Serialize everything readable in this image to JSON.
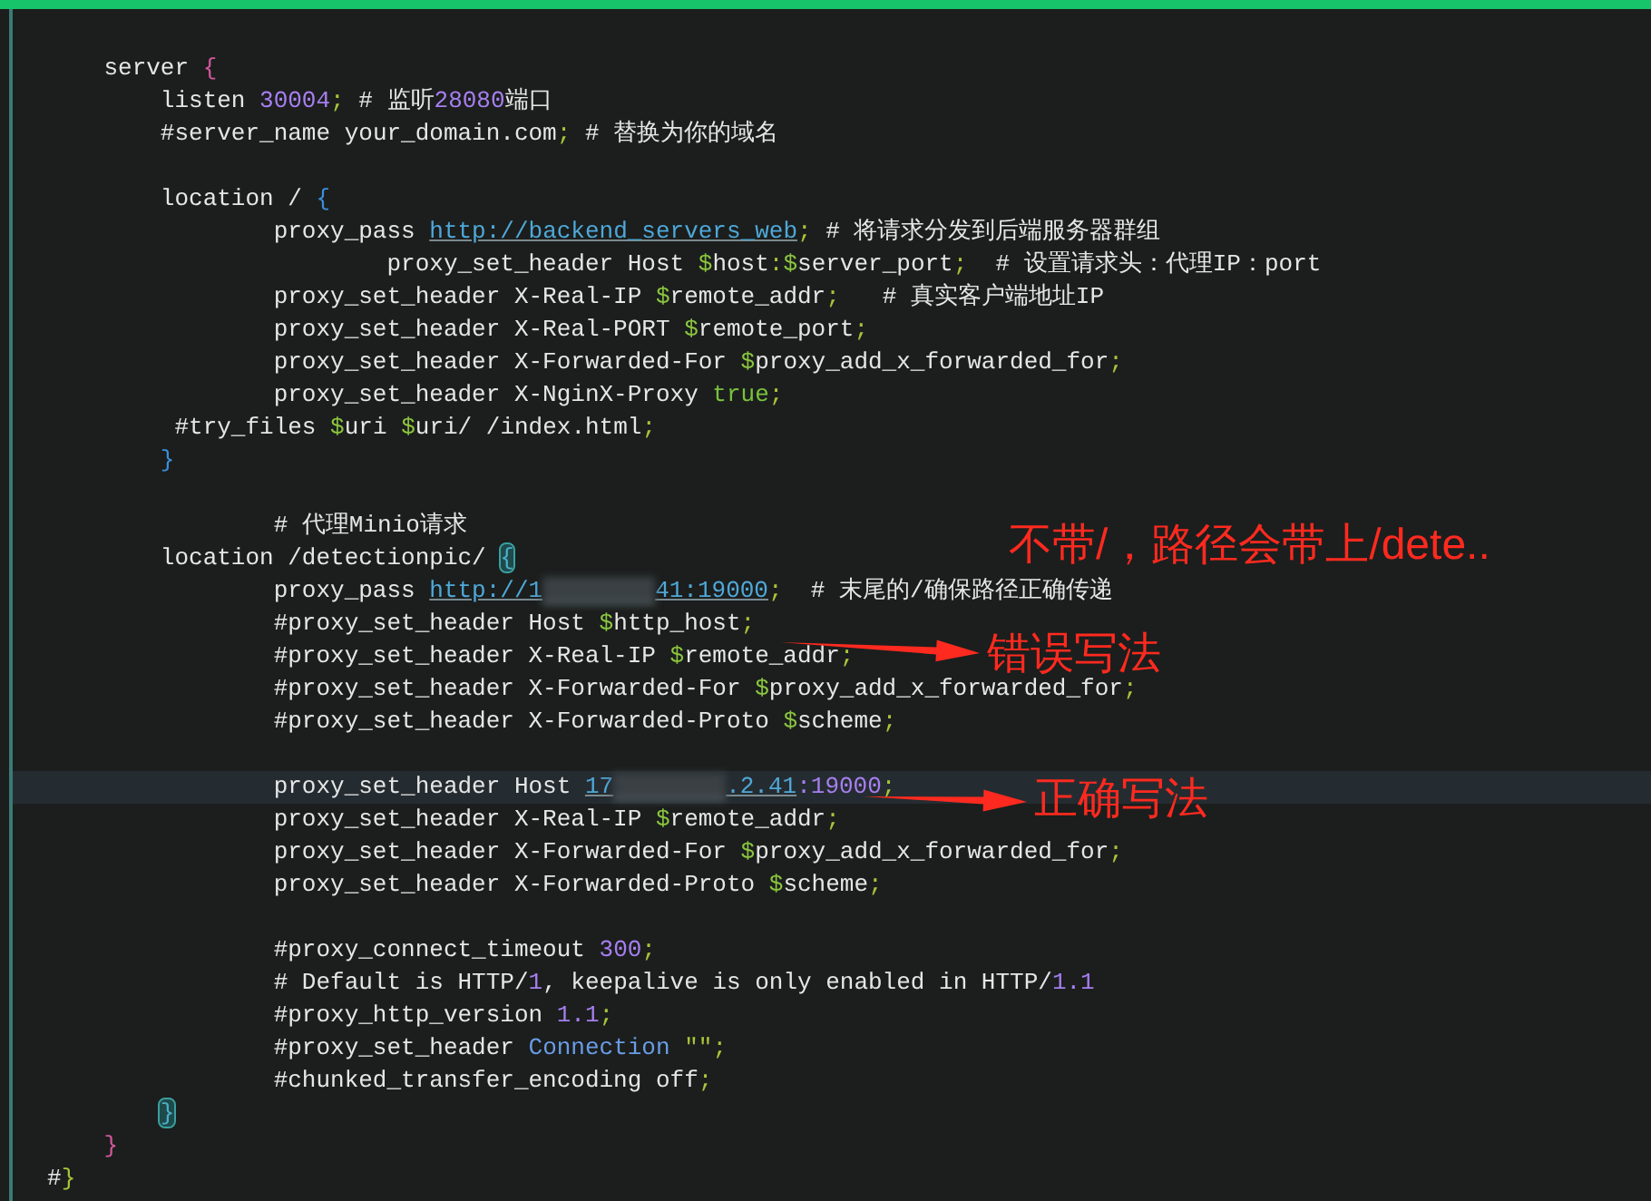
{
  "editor": {
    "lines": [
      {
        "current": false,
        "tokens": [
          {
            "kind": "text",
            "text": "    server "
          },
          {
            "kind": "brace",
            "text": "{"
          }
        ]
      },
      {
        "current": false,
        "tokens": [
          {
            "kind": "text",
            "text": "        listen "
          },
          {
            "kind": "number",
            "text": "30004"
          },
          {
            "kind": "punct",
            "text": ";"
          },
          {
            "kind": "text",
            "text": " # 监听"
          },
          {
            "kind": "number",
            "text": "28080"
          },
          {
            "kind": "text",
            "text": "端口"
          }
        ]
      },
      {
        "current": false,
        "tokens": [
          {
            "kind": "text",
            "text": "        #server_name your_domain.com"
          },
          {
            "kind": "punct",
            "text": ";"
          },
          {
            "kind": "text",
            "text": " # 替换为你的域名"
          }
        ]
      },
      {
        "current": false
      },
      {
        "current": false,
        "tokens": [
          {
            "kind": "text",
            "text": "        location / "
          },
          {
            "kind": "block",
            "text": "{"
          }
        ]
      },
      {
        "current": false,
        "tokens": [
          {
            "kind": "text",
            "text": "                proxy_pass "
          },
          {
            "kind": "url",
            "text": "http://backend_servers_web"
          },
          {
            "kind": "punct",
            "text": ";"
          },
          {
            "kind": "text",
            "text": " # 将请求分发到后端服务器群组"
          }
        ]
      },
      {
        "current": false,
        "tokens": [
          {
            "kind": "text",
            "text": "                        proxy_set_header Host "
          },
          {
            "kind": "variable",
            "text": "$"
          },
          {
            "kind": "text",
            "text": "host"
          },
          {
            "kind": "punct",
            "text": ":"
          },
          {
            "kind": "variable",
            "text": "$"
          },
          {
            "kind": "text",
            "text": "server_port"
          },
          {
            "kind": "punct",
            "text": ";"
          },
          {
            "kind": "text",
            "text": "  # 设置请求头：代理IP：port"
          }
        ]
      },
      {
        "current": false,
        "tokens": [
          {
            "kind": "text",
            "text": "                proxy_set_header X-Real-IP "
          },
          {
            "kind": "variable",
            "text": "$"
          },
          {
            "kind": "text",
            "text": "remote_addr"
          },
          {
            "kind": "punct",
            "text": ";"
          },
          {
            "kind": "text",
            "text": "   # 真实客户端地址IP"
          }
        ]
      },
      {
        "current": false,
        "tokens": [
          {
            "kind": "text",
            "text": "                proxy_set_header X-Real-PORT "
          },
          {
            "kind": "variable",
            "text": "$"
          },
          {
            "kind": "text",
            "text": "remote_port"
          },
          {
            "kind": "punct",
            "text": ";"
          }
        ]
      },
      {
        "current": false,
        "tokens": [
          {
            "kind": "text",
            "text": "                proxy_set_header X-Forwarded-For "
          },
          {
            "kind": "variable",
            "text": "$"
          },
          {
            "kind": "text",
            "text": "proxy_add_x_forwarded_for"
          },
          {
            "kind": "punct",
            "text": ";"
          }
        ]
      },
      {
        "current": false,
        "tokens": [
          {
            "kind": "text",
            "text": "                proxy_set_header X-NginX-Proxy "
          },
          {
            "kind": "bool",
            "text": "true"
          },
          {
            "kind": "punct",
            "text": ";"
          }
        ]
      },
      {
        "current": false,
        "tokens": [
          {
            "kind": "text",
            "text": "         #try_files "
          },
          {
            "kind": "variable",
            "text": "$"
          },
          {
            "kind": "text",
            "text": "uri "
          },
          {
            "kind": "variable",
            "text": "$"
          },
          {
            "kind": "text",
            "text": "uri/ /index.html"
          },
          {
            "kind": "punct",
            "text": ";"
          }
        ]
      },
      {
        "current": false,
        "tokens": [
          {
            "kind": "block",
            "text": "        }"
          }
        ]
      },
      {
        "current": false
      },
      {
        "current": false,
        "tokens": [
          {
            "kind": "text",
            "text": "                # 代理Minio请求"
          }
        ]
      },
      {
        "current": false,
        "tokens": [
          {
            "kind": "text",
            "text": "        location /detectionpic/ "
          },
          {
            "kind": "match",
            "text": "{"
          }
        ]
      },
      {
        "current": false,
        "tokens": [
          {
            "kind": "text",
            "text": "                proxy_pass "
          },
          {
            "kind": "url",
            "text": "http://1"
          },
          {
            "kind": "redacted"
          },
          {
            "kind": "url",
            "text": "41:19000"
          },
          {
            "kind": "punct",
            "text": ";"
          },
          {
            "kind": "text",
            "text": "  # 末尾的/确保路径正确传递"
          }
        ]
      },
      {
        "current": false,
        "tokens": [
          {
            "kind": "text",
            "text": "                #proxy_set_header Host "
          },
          {
            "kind": "variable",
            "text": "$"
          },
          {
            "kind": "text",
            "text": "http_host"
          },
          {
            "kind": "punct",
            "text": ";"
          }
        ]
      },
      {
        "current": false,
        "tokens": [
          {
            "kind": "text",
            "text": "                #proxy_set_header X-Real-IP "
          },
          {
            "kind": "variable",
            "text": "$"
          },
          {
            "kind": "text",
            "text": "remote_addr"
          },
          {
            "kind": "punct",
            "text": ";"
          }
        ]
      },
      {
        "current": false,
        "tokens": [
          {
            "kind": "text",
            "text": "                #proxy_set_header X-Forwarded-For "
          },
          {
            "kind": "variable",
            "text": "$"
          },
          {
            "kind": "text",
            "text": "proxy_add_x_forwarded_for"
          },
          {
            "kind": "punct",
            "text": ";"
          }
        ]
      },
      {
        "current": false,
        "tokens": [
          {
            "kind": "text",
            "text": "                #proxy_set_header X-Forwarded-Proto "
          },
          {
            "kind": "variable",
            "text": "$"
          },
          {
            "kind": "text",
            "text": "scheme"
          },
          {
            "kind": "punct",
            "text": ";"
          }
        ]
      },
      {
        "current": false
      },
      {
        "current": true,
        "tokens": [
          {
            "kind": "text",
            "text": "                proxy_set_header Host "
          },
          {
            "kind": "url",
            "text": "17"
          },
          {
            "kind": "redacted"
          },
          {
            "kind": "url",
            "text": ".2.41"
          },
          {
            "kind": "number",
            "text": ":19000"
          },
          {
            "kind": "punct",
            "text": ";"
          }
        ]
      },
      {
        "current": false,
        "tokens": [
          {
            "kind": "text",
            "text": "                proxy_set_header X-Real-IP "
          },
          {
            "kind": "variable",
            "text": "$"
          },
          {
            "kind": "text",
            "text": "remote_addr"
          },
          {
            "kind": "punct",
            "text": ";"
          }
        ]
      },
      {
        "current": false,
        "tokens": [
          {
            "kind": "text",
            "text": "                proxy_set_header X-Forwarded-For "
          },
          {
            "kind": "variable",
            "text": "$"
          },
          {
            "kind": "text",
            "text": "proxy_add_x_forwarded_for"
          },
          {
            "kind": "punct",
            "text": ";"
          }
        ]
      },
      {
        "current": false,
        "tokens": [
          {
            "kind": "text",
            "text": "                proxy_set_header X-Forwarded-Proto "
          },
          {
            "kind": "variable",
            "text": "$"
          },
          {
            "kind": "text",
            "text": "scheme"
          },
          {
            "kind": "punct",
            "text": ";"
          }
        ]
      },
      {
        "current": false
      },
      {
        "current": false,
        "tokens": [
          {
            "kind": "text",
            "text": "                #proxy_connect_timeout "
          },
          {
            "kind": "number",
            "text": "300"
          },
          {
            "kind": "punct",
            "text": ";"
          }
        ]
      },
      {
        "current": false,
        "tokens": [
          {
            "kind": "text",
            "text": "                # Default is HTTP/"
          },
          {
            "kind": "number",
            "text": "1"
          },
          {
            "kind": "text",
            "text": ", keepalive is only enabled in HTTP/"
          },
          {
            "kind": "number",
            "text": "1.1"
          }
        ]
      },
      {
        "current": false,
        "tokens": [
          {
            "kind": "text",
            "text": "                #proxy_http_version "
          },
          {
            "kind": "number",
            "text": "1.1"
          },
          {
            "kind": "punct",
            "text": ";"
          }
        ]
      },
      {
        "current": false,
        "tokens": [
          {
            "kind": "text",
            "text": "                #proxy_set_header "
          },
          {
            "kind": "keyword",
            "text": "Connection"
          },
          {
            "kind": "punct",
            "text": " \"\""
          },
          {
            "kind": "punct",
            "text": ";"
          }
        ]
      },
      {
        "current": false,
        "tokens": [
          {
            "kind": "text",
            "text": "                #chunked_transfer_encoding off"
          },
          {
            "kind": "punct",
            "text": ";"
          }
        ]
      },
      {
        "current": false,
        "tokens": [
          {
            "kind": "match",
            "text": "        }"
          }
        ]
      },
      {
        "current": false,
        "tokens": [
          {
            "kind": "brace",
            "text": "    }"
          }
        ]
      },
      {
        "current": false,
        "tokens": [
          {
            "kind": "text",
            "text": "#"
          },
          {
            "kind": "punct",
            "text": "}"
          }
        ]
      }
    ]
  },
  "annotations": [
    {
      "text": "不带/，路径会带上/dete..",
      "arrow": false
    },
    {
      "text": "错误写法",
      "arrow": true
    },
    {
      "text": "正确写法",
      "arrow": true
    }
  ]
}
